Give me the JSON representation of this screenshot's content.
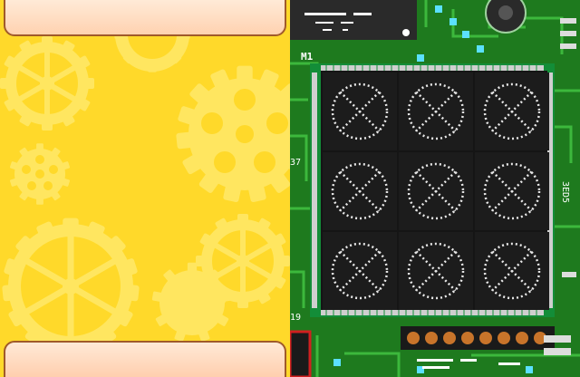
{
  "game": {
    "left_panel": {
      "theme_color": "#ffd92a",
      "gear_color": "#ffe866"
    },
    "board": {
      "pcb_color": "#1e7a1e",
      "chip_label": "M1",
      "silkscreen_labels": [
        "37",
        "19",
        "3ED5"
      ],
      "grid": {
        "rows": 3,
        "cols": 3,
        "cell_icon": "crossed-circle-icon"
      }
    }
  }
}
